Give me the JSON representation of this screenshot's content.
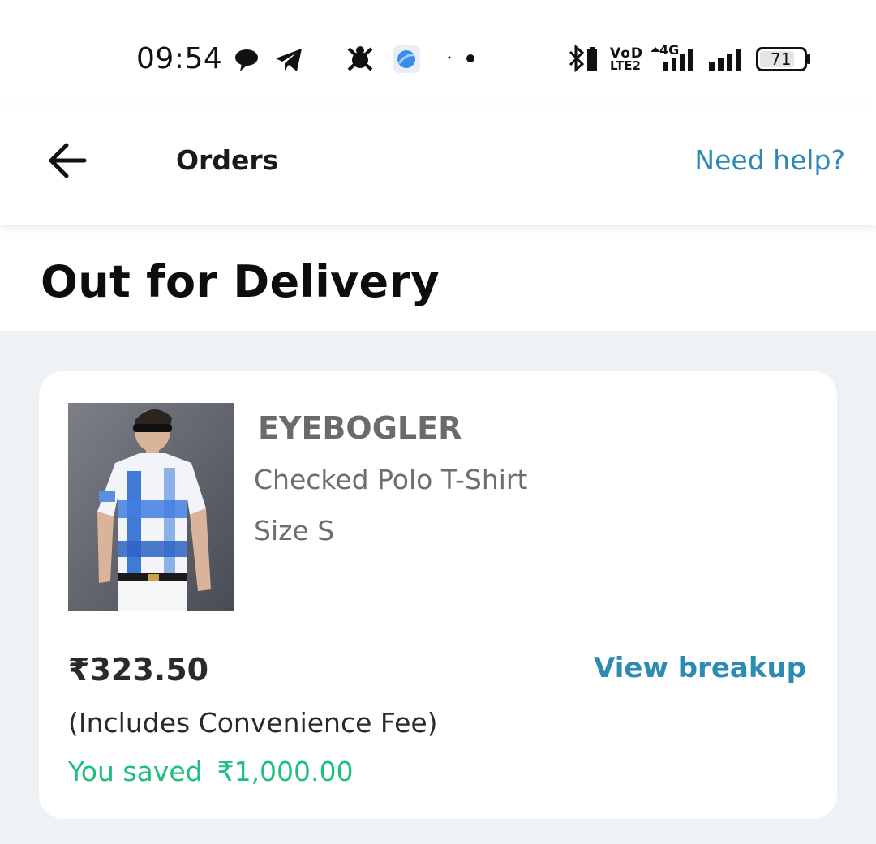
{
  "status_bar": {
    "time": "09:54",
    "carrier_label_top": "VoD",
    "carrier_label_bottom": "LTE2",
    "network_type": "4G",
    "battery_level": "71",
    "icons": [
      "chat-bubble-icon",
      "telegram-icon",
      "bug-app-icon",
      "app-orb-icon",
      "dots-icon",
      "bluetooth-icon",
      "battery-small-icon",
      "signal-icon",
      "signal-icon",
      "battery-icon"
    ]
  },
  "header": {
    "title": "Orders",
    "help_label": "Need help?",
    "back_icon": "arrow-left-icon"
  },
  "order": {
    "status": "Out for Delivery",
    "brand": "EYEBOGLER",
    "product_name": "Checked Polo T-Shirt",
    "size": "Size S",
    "price": "₹323.50",
    "view_breakup_label": "View breakup",
    "fee_note": "(Includes Convenience Fee)",
    "saved_label": "You saved",
    "saved_amount": "₹1,000.00"
  },
  "colors": {
    "accent_link": "#2d8ab3",
    "savings_green": "#1fbf80",
    "background": "#eff2f5"
  }
}
